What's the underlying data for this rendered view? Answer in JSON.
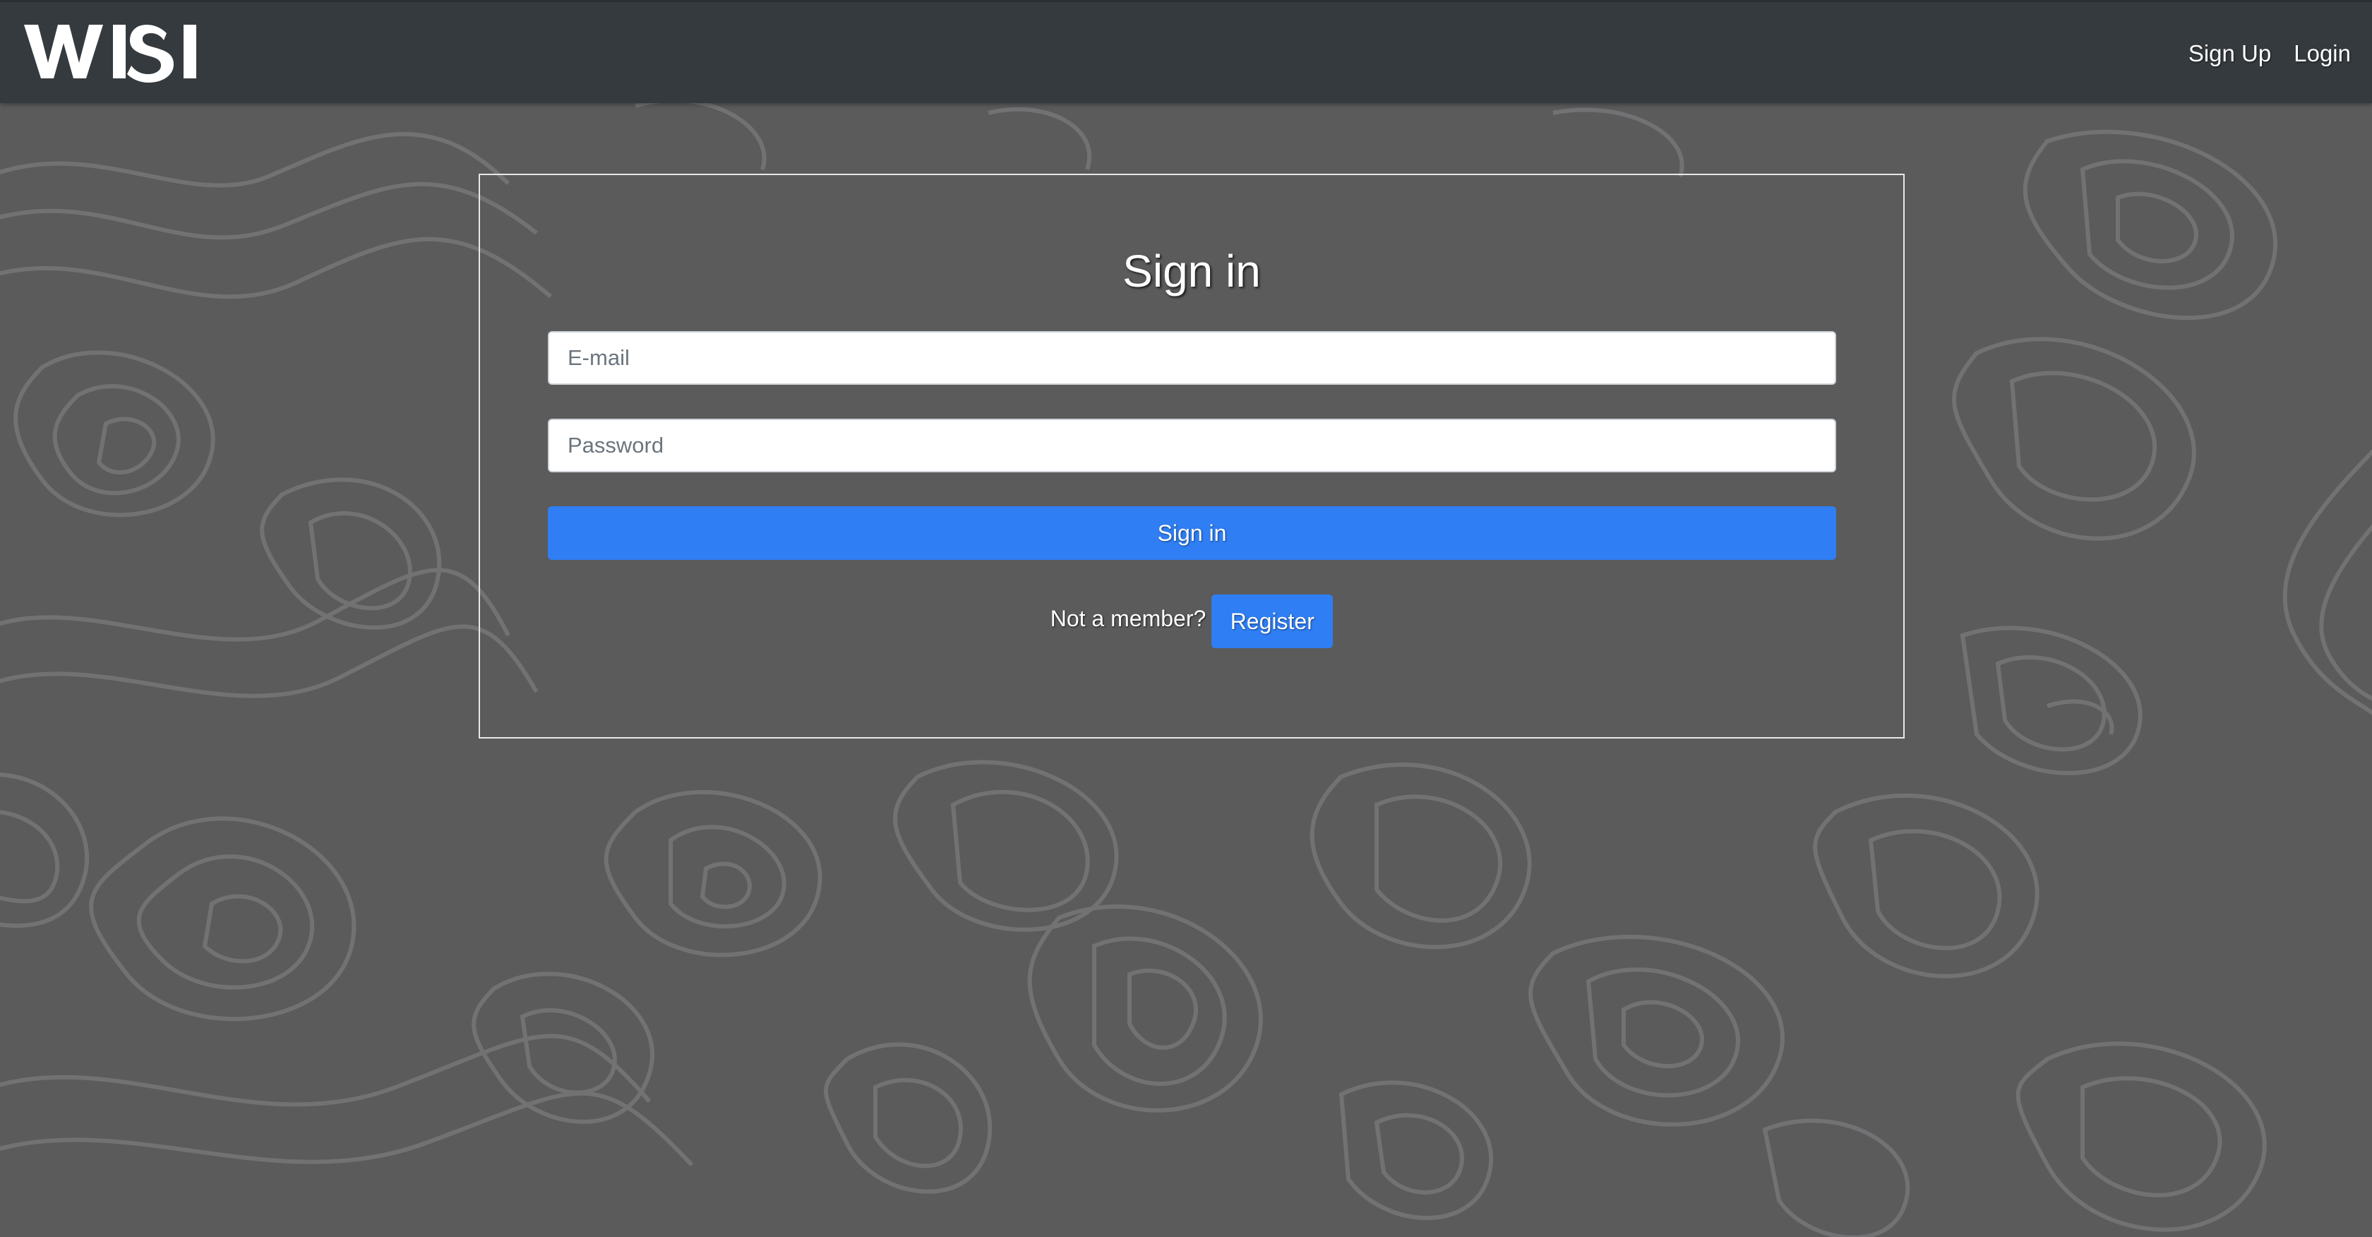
{
  "brand": {
    "logo_text": "WISI"
  },
  "nav": {
    "links": [
      {
        "label": "Sign Up"
      },
      {
        "label": "Login"
      }
    ]
  },
  "form": {
    "title": "Sign in",
    "email": {
      "placeholder": "E-mail",
      "value": ""
    },
    "password": {
      "placeholder": "Password",
      "value": ""
    },
    "submit_label": "Sign in",
    "register_prompt": "Not a member?",
    "register_label": "Register"
  },
  "colors": {
    "navbar": "#353a3f",
    "background": "#5b5b5c",
    "contour_lines": "#777778",
    "primary": "#2f7ef3",
    "card_border": "#e8e8e8"
  }
}
